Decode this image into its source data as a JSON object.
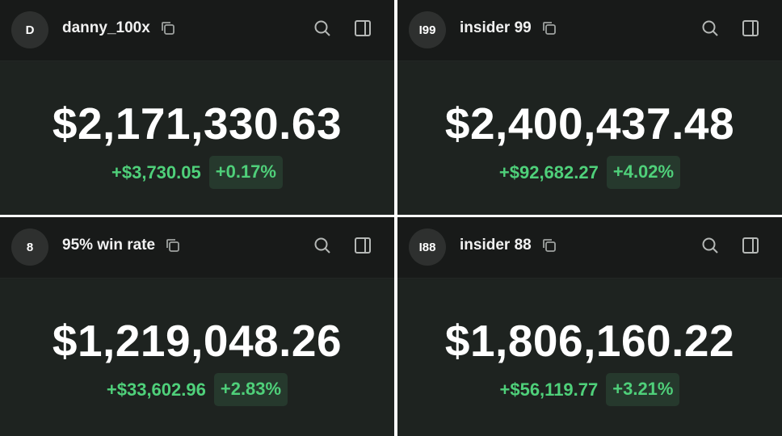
{
  "accounts": [
    {
      "avatar": "D",
      "name": "danny_100x",
      "balance": "$2,171,330.63",
      "change_amount": "+$3,730.05",
      "change_pct": "+0.17%"
    },
    {
      "avatar": "I99",
      "name": "insider 99",
      "balance": "$2,400,437.48",
      "change_amount": "+$92,682.27",
      "change_pct": "+4.02%"
    },
    {
      "avatar": "8",
      "name": "95% win rate",
      "balance": "$1,219,048.26",
      "change_amount": "+$33,602.96",
      "change_pct": "+2.83%"
    },
    {
      "avatar": "I88",
      "name": "insider 88",
      "balance": "$1,806,160.22",
      "change_amount": "+$56,119.77",
      "change_pct": "+3.21%"
    }
  ],
  "icons": {
    "copy": "copy-icon",
    "search": "search-icon",
    "sidebar": "sidebar-panel-icon"
  },
  "colors": {
    "positive": "#4fd07a",
    "positive_bg": "#26392d",
    "panel_bg": "#1e2320",
    "header_bg": "#181a19"
  }
}
